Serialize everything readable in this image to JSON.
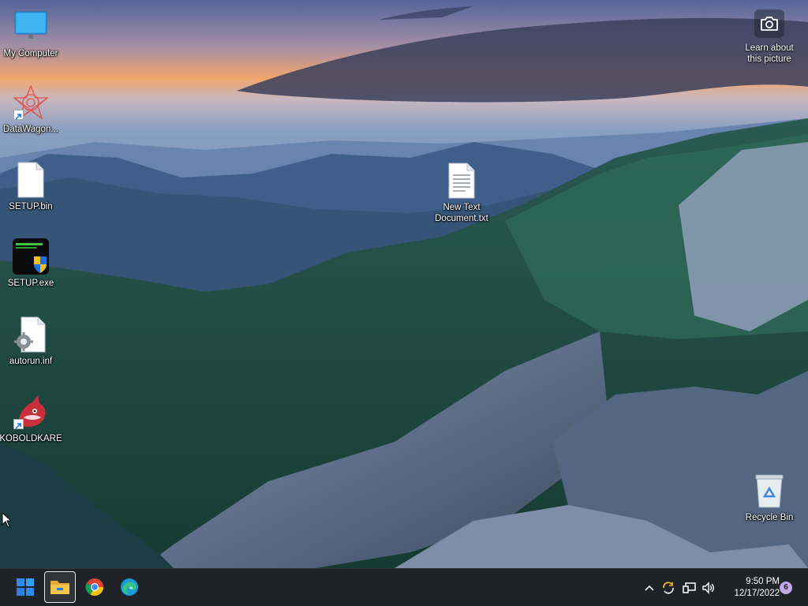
{
  "desktop": {
    "icons": [
      {
        "label": "My Computer",
        "icon": "monitor-icon"
      },
      {
        "label": "DataWagon...",
        "icon": "datawagon-app-icon"
      },
      {
        "label": "SETUP.bin",
        "icon": "file-icon"
      },
      {
        "label": "SETUP.exe",
        "icon": "setup-exe-icon"
      },
      {
        "label": "autorun.inf",
        "icon": "settings-file-icon"
      },
      {
        "label": "KOBOLDKARE",
        "icon": "kobold-app-icon"
      },
      {
        "label": "New Text\nDocument.txt",
        "icon": "text-file-icon"
      },
      {
        "label": "Recycle Bin",
        "icon": "recycle-bin-icon"
      }
    ],
    "learn_about": {
      "label": "Learn about\nthis picture",
      "icon": "camera-icon"
    }
  },
  "taskbar": {
    "apps": [
      {
        "name": "Start",
        "icon": "windows-start-icon"
      },
      {
        "name": "File Explorer",
        "icon": "folder-icon"
      },
      {
        "name": "Google Chrome",
        "icon": "chrome-icon"
      },
      {
        "name": "Microsoft Edge",
        "icon": "edge-icon"
      }
    ],
    "tray": {
      "icons": [
        "chevron-up-icon",
        "sync-icon",
        "network-icon",
        "volume-icon"
      ],
      "time": "9:50 PM",
      "date": "12/17/2022",
      "notification_count": "6"
    }
  },
  "colors": {
    "taskbar_bg": "#1f2226",
    "start_blue": "#2f8cf0",
    "folder_yellow": "#f3c54b",
    "badge_purple": "#c3a8e8"
  }
}
